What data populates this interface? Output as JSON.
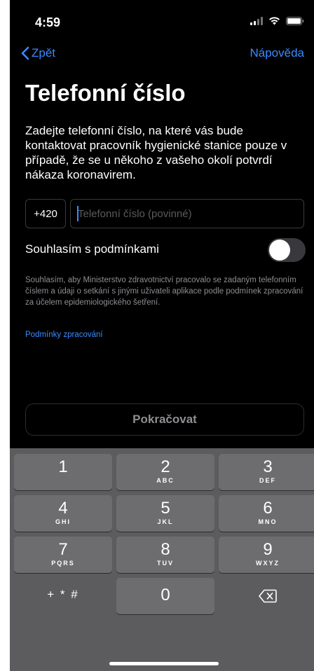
{
  "status_bar": {
    "time": "4:59"
  },
  "nav": {
    "back_label": "Zpět",
    "help_label": "Nápověda"
  },
  "page": {
    "title": "Telefonní číslo",
    "description": "Zadejte telefonní číslo, na které vás bude kontaktovat pracovník hygienické stanice pouze v případě, že se u někoho z vašeho okolí potvrdí nákaza koronavirem."
  },
  "phone_form": {
    "prefix": "+420",
    "phone_value": "",
    "phone_placeholder": "Telefonní číslo (povinné)"
  },
  "consent": {
    "label": "Souhlasím s podmínkami",
    "toggle_on": false,
    "text": "Souhlasím, aby Ministerstvo zdravotnictví pracovalo se zadaným telefonním číslem a údaji o setkání s jinými uživateli aplikace podle podmínek zpracování za účelem epidemiologického šetření.",
    "link_label": "Podmínky zpracování"
  },
  "continue_button": {
    "label": "Pokračovat",
    "enabled": false
  },
  "keypad": {
    "keys": [
      {
        "number": "1",
        "letters": ""
      },
      {
        "number": "2",
        "letters": "ABC"
      },
      {
        "number": "3",
        "letters": "DEF"
      },
      {
        "number": "4",
        "letters": "GHI"
      },
      {
        "number": "5",
        "letters": "JKL"
      },
      {
        "number": "6",
        "letters": "MNO"
      },
      {
        "number": "7",
        "letters": "PQRS"
      },
      {
        "number": "8",
        "letters": "TUV"
      },
      {
        "number": "9",
        "letters": "WXYZ"
      }
    ],
    "symbols_label": "+ * #",
    "zero": "0",
    "delete_icon": "delete-backspace-icon"
  },
  "colors": {
    "accent": "#3a8bff",
    "background": "#000000",
    "keyboard": "#5c5c5e",
    "key": "#6d6d70"
  }
}
